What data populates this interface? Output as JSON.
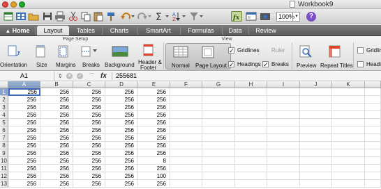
{
  "window": {
    "title": "Workbook9"
  },
  "toolbar": {
    "zoom": "100%",
    "help": "?"
  },
  "tabs": [
    "Home",
    "Layout",
    "Tables",
    "Charts",
    "SmartArt",
    "Formulas",
    "Data",
    "Review"
  ],
  "ribbon": {
    "page_setup_label": "Page Setup",
    "view_label": "View",
    "buttons": {
      "orientation": "Orientation",
      "size": "Size",
      "margins": "Margins",
      "breaks": "Breaks",
      "background": "Background",
      "header_footer_1": "Header &",
      "header_footer_2": "Footer",
      "normal": "Normal",
      "page_layout": "Page Layout",
      "preview": "Preview",
      "repeat_titles": "Repeat Titles"
    },
    "checks": {
      "gridlines": "Gridlines",
      "ruler": "Ruler",
      "headings": "Headings",
      "breaks": "Breaks",
      "gridlines2": "Gridlin",
      "headings2": "Headi"
    }
  },
  "formula_bar": {
    "cell_ref": "A1",
    "fx": "fx",
    "formula": "255681"
  },
  "columns": [
    "A",
    "B",
    "C",
    "D",
    "E",
    "F",
    "G",
    "H",
    "I",
    "J",
    "K"
  ],
  "rows": [
    "1",
    "2",
    "3",
    "4",
    "5",
    "6",
    "7",
    "8",
    "9",
    "10",
    "11",
    "12",
    "13"
  ],
  "cells": [
    [
      "256",
      "256",
      "256",
      "256",
      "256"
    ],
    [
      "256",
      "256",
      "256",
      "256",
      "256"
    ],
    [
      "256",
      "256",
      "256",
      "256",
      "256"
    ],
    [
      "256",
      "256",
      "256",
      "256",
      "256"
    ],
    [
      "256",
      "256",
      "256",
      "256",
      "256"
    ],
    [
      "256",
      "256",
      "256",
      "256",
      "256"
    ],
    [
      "256",
      "256",
      "256",
      "256",
      "256"
    ],
    [
      "256",
      "256",
      "256",
      "256",
      "256"
    ],
    [
      "256",
      "256",
      "256",
      "256",
      "256"
    ],
    [
      "256",
      "256",
      "256",
      "256",
      "8"
    ],
    [
      "256",
      "256",
      "256",
      "256",
      "256"
    ],
    [
      "256",
      "256",
      "256",
      "256",
      "100"
    ],
    [
      "256",
      "256",
      "256",
      "256",
      "256"
    ]
  ],
  "colors": {
    "selection": "#3a6bc0",
    "tab_bar": "#6b6b6b",
    "help": "#7a4fc8"
  }
}
